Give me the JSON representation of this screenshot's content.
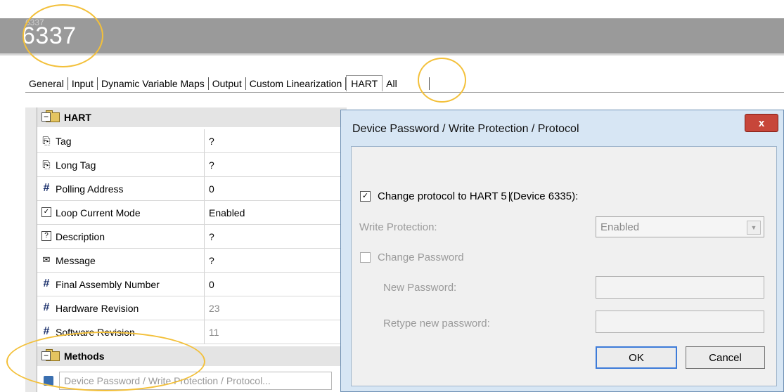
{
  "header": {
    "title": "6337",
    "ghost_text": "6337"
  },
  "tabs": [
    {
      "label": "General"
    },
    {
      "label": "Input"
    },
    {
      "label": "Dynamic Variable Maps"
    },
    {
      "label": "Output"
    },
    {
      "label": "Custom Linearization"
    },
    {
      "label": "HART"
    },
    {
      "label": "All"
    }
  ],
  "grid": {
    "category_hart": "HART",
    "rows": [
      {
        "name": "Tag",
        "value": "?",
        "icon": "clip-icon"
      },
      {
        "name": "Long Tag",
        "value": "?",
        "icon": "clip-icon"
      },
      {
        "name": "Polling Address",
        "value": "0",
        "icon": "hash-icon"
      },
      {
        "name": "Loop Current Mode",
        "value": "Enabled",
        "icon": "checkbox-icon"
      },
      {
        "name": "Description",
        "value": "?",
        "icon": "description-icon"
      },
      {
        "name": "Message",
        "value": "?",
        "icon": "envelope-icon"
      },
      {
        "name": "Final Assembly Number",
        "value": "0",
        "icon": "hash-icon"
      },
      {
        "name": "Hardware Revision",
        "value": "23",
        "icon": "hash-icon"
      },
      {
        "name": "Software Revision",
        "value": "11",
        "icon": "hash-icon"
      }
    ],
    "category_methods": "Methods",
    "method_item": "Device Password / Write Protection / Protocol..."
  },
  "dialog": {
    "title": "Device Password / Write Protection / Protocol",
    "close_label": "x",
    "change_protocol_label": "Change protocol to HART 5",
    "change_protocol_suffix": "(Device 6335):",
    "change_protocol_checked": true,
    "write_protection_label": "Write Protection:",
    "write_protection_value": "Enabled",
    "change_password_label": "Change Password",
    "new_password_label": "New Password:",
    "retype_password_label": "Retype new password:",
    "ok_label": "OK",
    "cancel_label": "Cancel"
  },
  "colors": {
    "highlight": "#f3c03a",
    "close_button": "#c7463a",
    "header_band": "#9a9a9a"
  }
}
